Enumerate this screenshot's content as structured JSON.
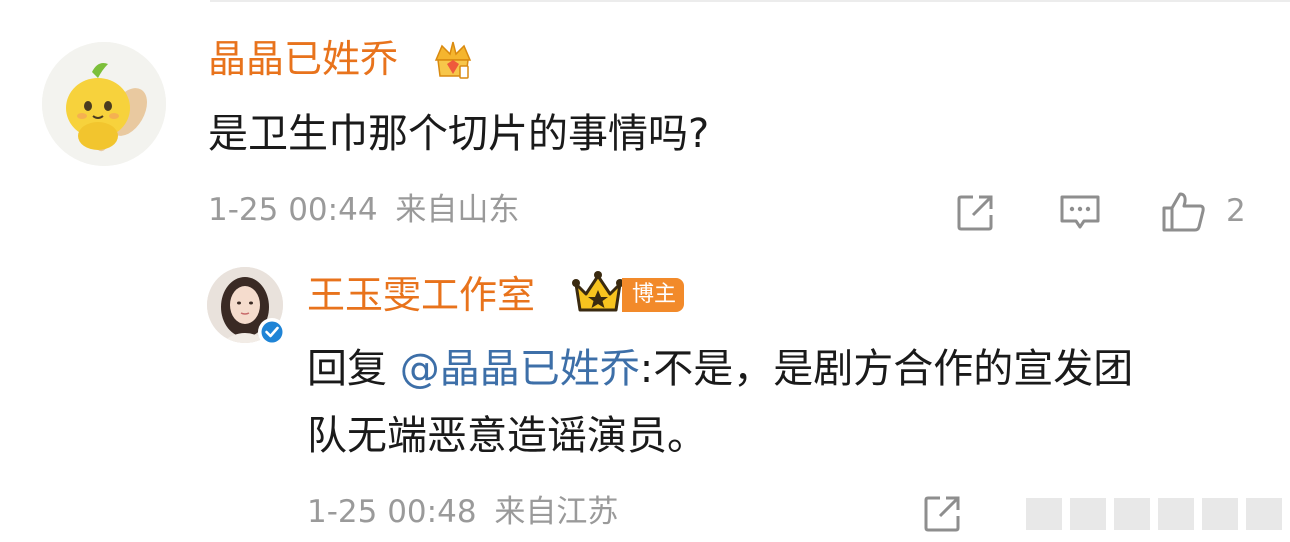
{
  "comment": {
    "username": "晶晶已姓乔",
    "text": "是卫生巾那个切片的事情吗?",
    "timestamp": "1-25 00:44",
    "location": "来自山东",
    "like_count": "2",
    "user_badge_icon": "crown-diamond-badge-icon"
  },
  "reply": {
    "username": "王玉雯工作室",
    "badge_label": "博主",
    "crown_icon": "gold-crown-icon",
    "verified_icon": "verified-check-icon",
    "text_prefix": "回复",
    "mention": "@晶晶已姓乔",
    "text_line1_rest": ":不是，是剧方合作的宣发团",
    "text_line2": "队无端恶意造谣演员。",
    "timestamp": "1-25 00:48",
    "location": "来自江苏"
  },
  "colors": {
    "username": "#e8731c",
    "mention": "#3d6fa8",
    "meta": "#9a9a9a",
    "text": "#1a1a1a",
    "badge": "#f28a2a",
    "verified": "#1f84d6"
  }
}
